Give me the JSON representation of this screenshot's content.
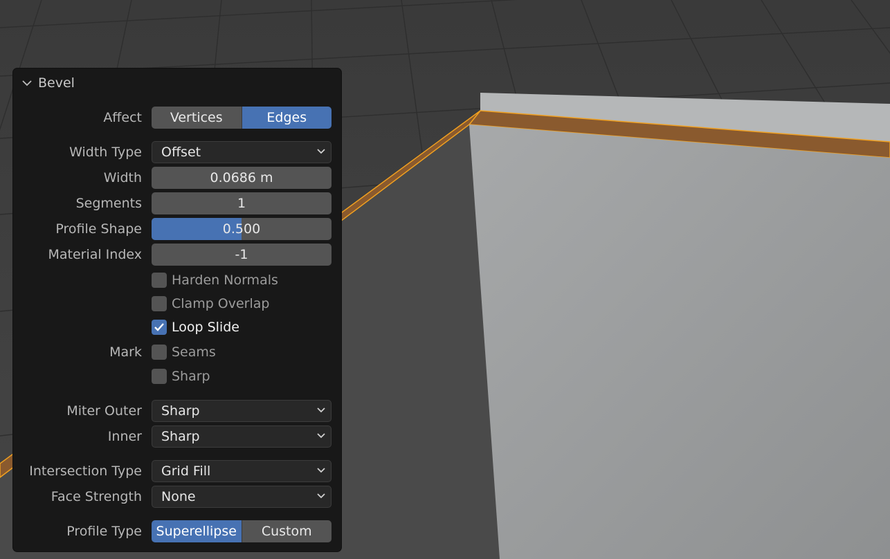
{
  "panel": {
    "title": "Bevel",
    "affect": {
      "label": "Affect",
      "options": [
        "Vertices",
        "Edges"
      ],
      "selected": "Edges"
    },
    "width_type": {
      "label": "Width Type",
      "value": "Offset"
    },
    "width": {
      "label": "Width",
      "value": "0.0686 m"
    },
    "segments": {
      "label": "Segments",
      "value": "1"
    },
    "profile_shape": {
      "label": "Profile Shape",
      "value": "0.500",
      "fraction": 0.5
    },
    "material_index": {
      "label": "Material Index",
      "value": "-1"
    },
    "harden_normals": {
      "label": "Harden Normals",
      "checked": false
    },
    "clamp_overlap": {
      "label": "Clamp Overlap",
      "checked": false
    },
    "loop_slide": {
      "label": "Loop Slide",
      "checked": true
    },
    "mark": {
      "label": "Mark",
      "seams": {
        "label": "Seams",
        "checked": false
      },
      "sharp": {
        "label": "Sharp",
        "checked": false
      }
    },
    "miter_outer": {
      "label": "Miter Outer",
      "value": "Sharp"
    },
    "inner": {
      "label": "Inner",
      "value": "Sharp"
    },
    "intersection_type": {
      "label": "Intersection Type",
      "value": "Grid Fill"
    },
    "face_strength": {
      "label": "Face Strength",
      "value": "None"
    },
    "profile_type": {
      "label": "Profile Type",
      "options": [
        "Superellipse",
        "Custom"
      ],
      "selected": "Superellipse"
    }
  },
  "colors": {
    "accent": "#4772b3",
    "bevel_face": "#8a5a2e",
    "selection_edge": "#f0a020",
    "mesh_face": "#9a9a9a",
    "panel_bg": "#181818"
  }
}
